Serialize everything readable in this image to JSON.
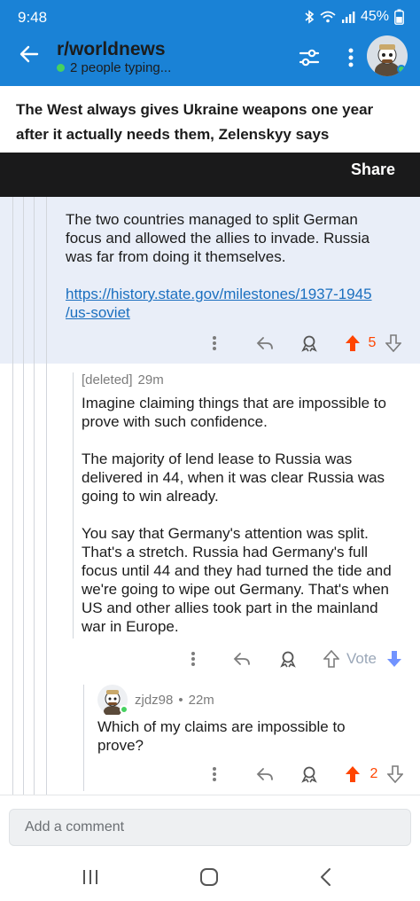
{
  "status": {
    "time": "9:48",
    "battery": "45%"
  },
  "header": {
    "subreddit": "r/worldnews",
    "typing": "2 people typing..."
  },
  "post": {
    "title": "The West always gives Ukraine weapons one year after it actually needs them, Zelenskyy says",
    "share_label": "Share"
  },
  "comments": [
    {
      "lines": [
        "The two countries managed to split German",
        "focus and allowed the allies to invade. Russia",
        "was far from doing it themselves."
      ],
      "link_lines": [
        "https://history.state.gov/milestones/1937-1945",
        "/us-soviet"
      ],
      "score": "5"
    },
    {
      "author": "[deleted]",
      "age": "29m",
      "paragraphs": [
        [
          "Imagine claiming things that are impossible to",
          "prove with such confidence."
        ],
        [
          "The majority of lend lease to Russia was",
          "delivered in 44, when it was clear Russia was",
          "going to win already."
        ],
        [
          "You say that Germany's attention was split.",
          "That's a stretch. Russia had Germany's full",
          "focus until 44 and they had turned the tide and",
          "we're going to wipe out Germany. That's when",
          "US and other allies took part in the mainland",
          "war in Europe."
        ]
      ],
      "vote_label": "Vote"
    },
    {
      "author": "zjdz98",
      "age": "22m",
      "lines": [
        "Which of my claims are impossible to",
        "prove?"
      ],
      "score": "2"
    }
  ],
  "composer": {
    "placeholder": "Add a comment"
  },
  "colors": {
    "header_bg": "#1a82d6",
    "share_bar_bg": "#1a1a1b",
    "upvote": "#ff4500",
    "downvote_active": "#7193ff",
    "link": "#1a6fbf",
    "online": "#46d160"
  },
  "icons": {
    "back": "arrow-left-icon",
    "filter": "sort-filter-icon",
    "more": "vertical-dots-icon",
    "reply": "reply-arrow-icon",
    "award": "award-icon",
    "upvote": "upvote-arrow-icon",
    "downvote": "downvote-arrow-icon"
  }
}
